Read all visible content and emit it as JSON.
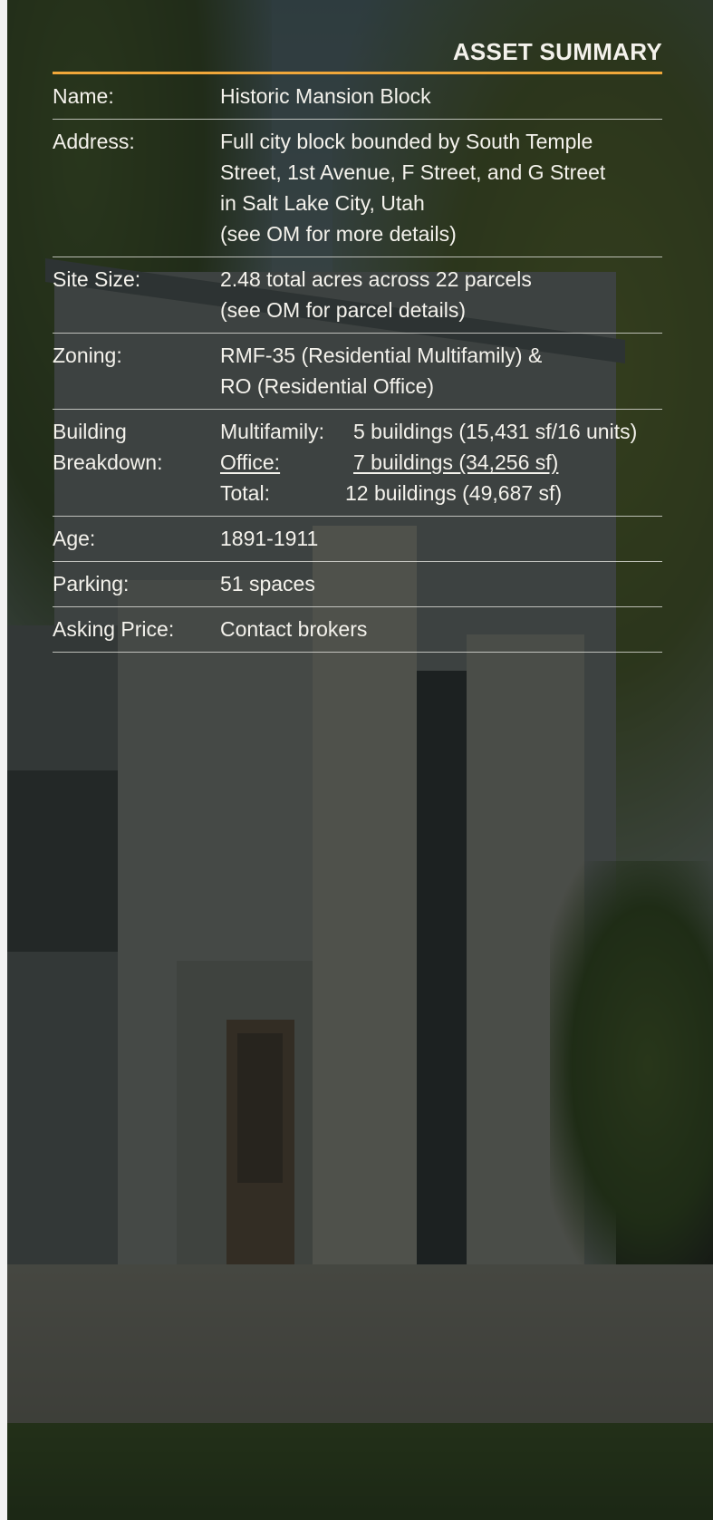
{
  "summary": {
    "title": "ASSET SUMMARY",
    "name": {
      "label": "Name:",
      "value": "Historic Mansion Block"
    },
    "address": {
      "label": "Address:",
      "lines": [
        "Full city block bounded by South Temple",
        "Street, 1st Avenue, F Street, and G Street",
        "in Salt Lake City, Utah",
        "(see OM for more details)"
      ]
    },
    "site_size": {
      "label": "Site Size:",
      "lines": [
        "2.48 total acres across 22 parcels",
        "(see OM for parcel details)"
      ]
    },
    "zoning": {
      "label": "Zoning:",
      "lines": [
        "RMF-35 (Residential Multifamily) &",
        "RO (Residential Office)"
      ]
    },
    "building_breakdown": {
      "label_line1": "Building",
      "label_line2": "Breakdown:",
      "items": [
        {
          "name": "Multifamily:",
          "value": "5 buildings (15,431 sf/16 units)"
        },
        {
          "name": "Office:",
          "value": "7 buildings (34,256 sf)"
        },
        {
          "name": "Total:",
          "value": "12 buildings (49,687 sf)"
        }
      ]
    },
    "age": {
      "label": "Age:",
      "value": "1891-1911"
    },
    "parking": {
      "label": "Parking:",
      "value": "51 spaces"
    },
    "asking_price": {
      "label": "Asking Price:",
      "value": "Contact brokers"
    }
  },
  "colors": {
    "accent_rule": "#f0a73a",
    "text": "#f4f2ec"
  }
}
